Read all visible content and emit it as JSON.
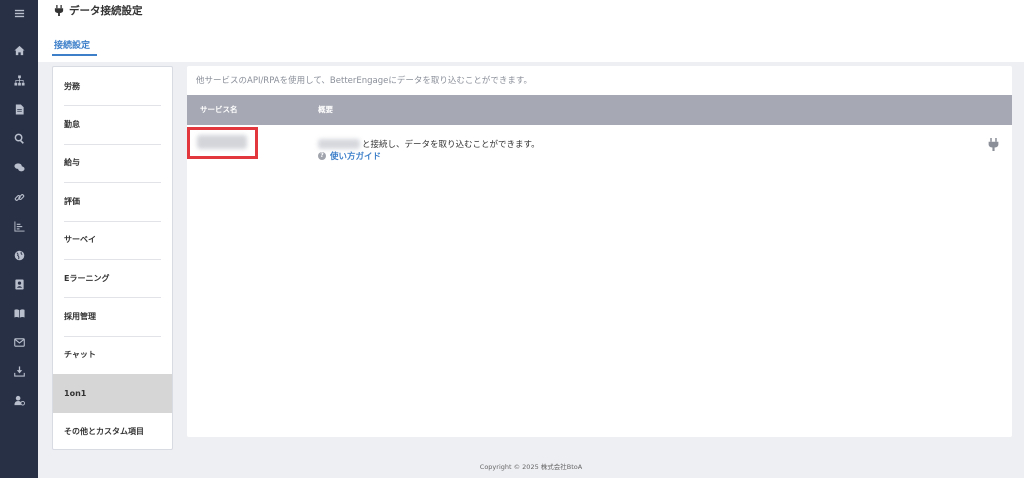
{
  "header": {
    "title": "データ接続設定",
    "tab_label": "接続設定"
  },
  "sidemenu": {
    "items": [
      {
        "label": "労務"
      },
      {
        "label": "勤怠"
      },
      {
        "label": "給与"
      },
      {
        "label": "評価"
      },
      {
        "label": "サーベイ"
      },
      {
        "label": "Eラーニング"
      },
      {
        "label": "採用管理"
      },
      {
        "label": "チャット"
      },
      {
        "label": "1on1",
        "active": true
      },
      {
        "label": "その他とカスタム項目"
      }
    ]
  },
  "panel": {
    "intro": "他サービスのAPI/RPAを使用して、BetterEngageにデータを取り込むことができます。",
    "table": {
      "headers": [
        "サービス名",
        "概要"
      ],
      "rows": [
        {
          "description": "と接続し、データを取り込むことができます。",
          "guide_link": "使い方ガイド"
        }
      ]
    }
  },
  "footer": {
    "copyright": "Copyright © 2025 株式会社BtoA"
  },
  "nav_icons": [
    "menu-icon",
    "home-icon",
    "org-chart-icon",
    "document-icon",
    "search-icon",
    "chat-icon",
    "link-icon",
    "chart-icon",
    "globe-icon",
    "contact-card-icon",
    "book-icon",
    "mail-icon",
    "download-icon",
    "user-settings-icon"
  ],
  "colors": {
    "sidebar": "#283046",
    "accent": "#3d7fc9",
    "table_header": "#a6a8b3",
    "highlight": "#e2373d"
  }
}
